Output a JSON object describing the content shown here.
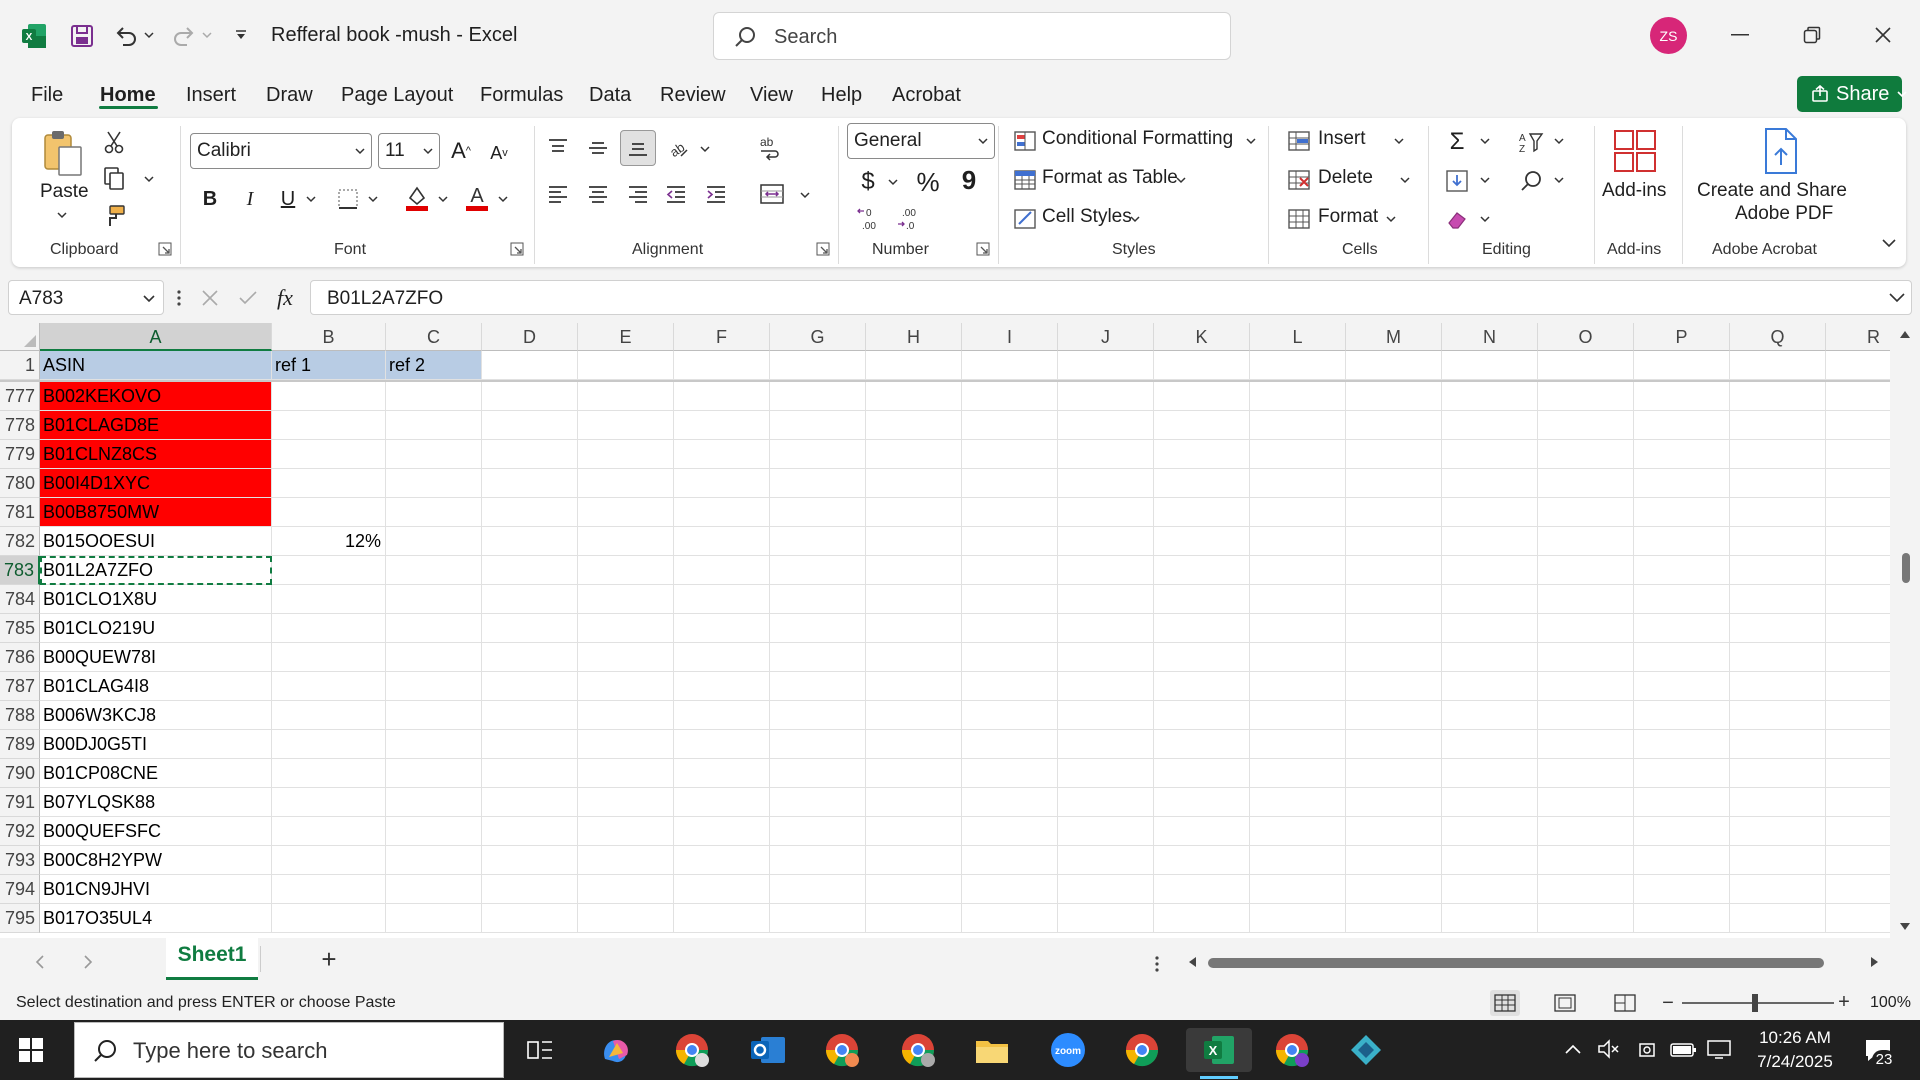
{
  "window": {
    "title": "Refferal book -mush  -  Excel",
    "search_placeholder": "Search",
    "avatar_initials": "ZS"
  },
  "menu": {
    "tabs": [
      "File",
      "Home",
      "Insert",
      "Draw",
      "Page Layout",
      "Formulas",
      "Data",
      "Review",
      "View",
      "Help",
      "Acrobat"
    ],
    "active_tab": "Home",
    "share_label": "Share"
  },
  "ribbon": {
    "clipboard": {
      "paste_label": "Paste",
      "group_label": "Clipboard"
    },
    "font": {
      "font_name": "Calibri",
      "font_size": "11",
      "bold": "B",
      "italic": "I",
      "underline": "U",
      "group_label": "Font"
    },
    "alignment": {
      "group_label": "Alignment"
    },
    "number": {
      "format": "General",
      "currency": "$",
      "percent": "%",
      "comma": "9",
      "group_label": "Number"
    },
    "styles": {
      "conditional_formatting": "Conditional Formatting",
      "format_as_table": "Format as Table",
      "cell_styles": "Cell Styles",
      "group_label": "Styles"
    },
    "cells": {
      "insert": "Insert",
      "delete": "Delete",
      "format": "Format",
      "group_label": "Cells"
    },
    "editing": {
      "group_label": "Editing"
    },
    "addins": {
      "label": "Add-ins",
      "group_label": "Add-ins"
    },
    "acrobat": {
      "label_line1": "Create and Share",
      "label_line2": "Adobe PDF",
      "group_label": "Adobe Acrobat"
    }
  },
  "formula_bar": {
    "name_box": "A783",
    "fx": "fx",
    "content": "B01L2A7ZFO"
  },
  "grid": {
    "columns": [
      "A",
      "B",
      "C",
      "D",
      "E",
      "F",
      "G",
      "H",
      "I",
      "J",
      "K",
      "L",
      "M",
      "N",
      "O",
      "P",
      "Q",
      "R"
    ],
    "selected_column": "A",
    "header_row": {
      "row": "1",
      "a": "ASIN",
      "b": "ref 1",
      "c": "ref 2"
    },
    "rows": [
      {
        "row": "777",
        "a": "B002KEKOVO",
        "b": "",
        "highlight": "#ff0000"
      },
      {
        "row": "778",
        "a": "B01CLAGD8E",
        "b": "",
        "highlight": "#ff0000"
      },
      {
        "row": "779",
        "a": "B01CLNZ8CS",
        "b": "",
        "highlight": "#ff0000"
      },
      {
        "row": "780",
        "a": "B00I4D1XYC",
        "b": "",
        "highlight": "#ff0000"
      },
      {
        "row": "781",
        "a": "B00B8750MW",
        "b": "",
        "highlight": "#ff0000"
      },
      {
        "row": "782",
        "a": "B015OOESUI",
        "b": "12%",
        "highlight": ""
      },
      {
        "row": "783",
        "a": "B01L2A7ZFO",
        "b": "",
        "highlight": ""
      },
      {
        "row": "784",
        "a": "B01CLO1X8U",
        "b": "",
        "highlight": ""
      },
      {
        "row": "785",
        "a": "B01CLO219U",
        "b": "",
        "highlight": ""
      },
      {
        "row": "786",
        "a": "B00QUEW78I",
        "b": "",
        "highlight": ""
      },
      {
        "row": "787",
        "a": "B01CLAG4I8",
        "b": "",
        "highlight": ""
      },
      {
        "row": "788",
        "a": "B006W3KCJ8",
        "b": "",
        "highlight": ""
      },
      {
        "row": "789",
        "a": "B00DJ0G5TI",
        "b": "",
        "highlight": ""
      },
      {
        "row": "790",
        "a": "B01CP08CNE",
        "b": "",
        "highlight": ""
      },
      {
        "row": "791",
        "a": "B07YLQSK88",
        "b": "",
        "highlight": ""
      },
      {
        "row": "792",
        "a": "B00QUEFSFC",
        "b": "",
        "highlight": ""
      },
      {
        "row": "793",
        "a": "B00C8H2YPW",
        "b": "",
        "highlight": ""
      },
      {
        "row": "794",
        "a": "B01CN9JHVI",
        "b": "",
        "highlight": ""
      },
      {
        "row": "795",
        "a": "B017O35UL4",
        "b": "",
        "highlight": ""
      }
    ],
    "active_row": "783",
    "header_fill": "#b8cce4"
  },
  "sheets": {
    "tabs": [
      "Sheet1"
    ],
    "active": "Sheet1",
    "add_label": "+"
  },
  "status": {
    "message": "Select destination and press ENTER or choose Paste",
    "zoom": "100%"
  },
  "taskbar": {
    "search_placeholder": "Type here to search",
    "time": "10:26 AM",
    "date": "7/24/2025",
    "notification_count": "23"
  },
  "colors": {
    "accent": "#107c41",
    "highlight_red": "#ff0000",
    "header_blue": "#b8cce4"
  }
}
